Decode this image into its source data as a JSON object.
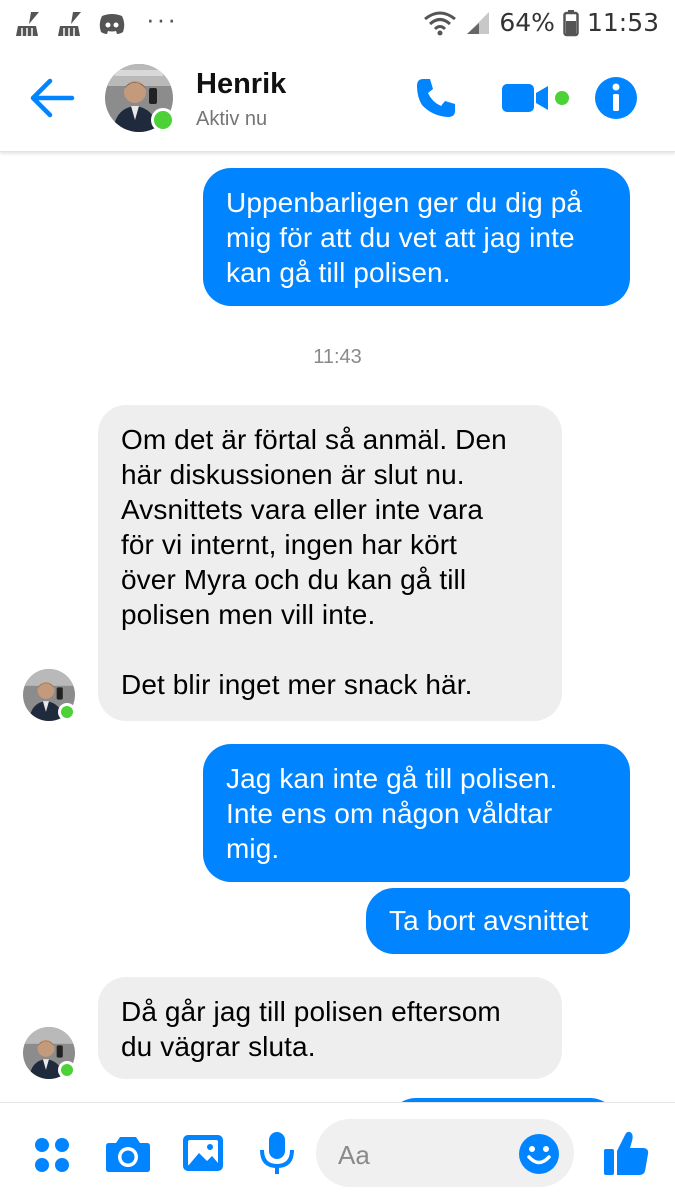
{
  "status_bar": {
    "battery_percent": "64%",
    "time": "11:53",
    "dots": "···"
  },
  "header": {
    "contact_name": "Henrik",
    "presence": "Aktiv nu"
  },
  "messages": [
    {
      "sender": "me",
      "lines": [
        "Uppenbarligen ger du dig på",
        "mig för att du vet att jag inte",
        "kan gå till polisen."
      ]
    },
    {
      "type": "timestamp",
      "text": "11:43"
    },
    {
      "sender": "contact",
      "lines": [
        "Om det är förtal så anmäl. Den",
        "här diskussionen är slut nu.",
        "Avsnittets vara eller inte vara",
        "för vi internt, ingen har kört",
        "över Myra och du kan gå till",
        "polisen men vill inte.",
        "",
        "Det blir inget mer snack här."
      ]
    },
    {
      "sender": "me",
      "lines": [
        "Jag kan inte gå till polisen.",
        "Inte ens om någon våldtar",
        "mig."
      ]
    },
    {
      "sender": "me",
      "lines": [
        "Ta bort avsnittet"
      ]
    },
    {
      "sender": "contact",
      "lines": [
        "Då går jag till polisen eftersom",
        "du vägrar sluta."
      ]
    }
  ],
  "composer": {
    "placeholder": "Aa"
  },
  "colors": {
    "accent": "#0084ff",
    "online": "#4cd137",
    "incoming_bubble": "#eeeeee"
  },
  "icons": [
    "sweep-icon",
    "sweep-icon",
    "discord-icon",
    "wifi-icon",
    "signal-icon",
    "battery-icon",
    "back-arrow-icon",
    "phone-icon",
    "video-camera-icon",
    "info-icon",
    "apps-grid-icon",
    "camera-icon",
    "image-icon",
    "microphone-icon",
    "emoji-icon",
    "thumbs-up-icon"
  ]
}
